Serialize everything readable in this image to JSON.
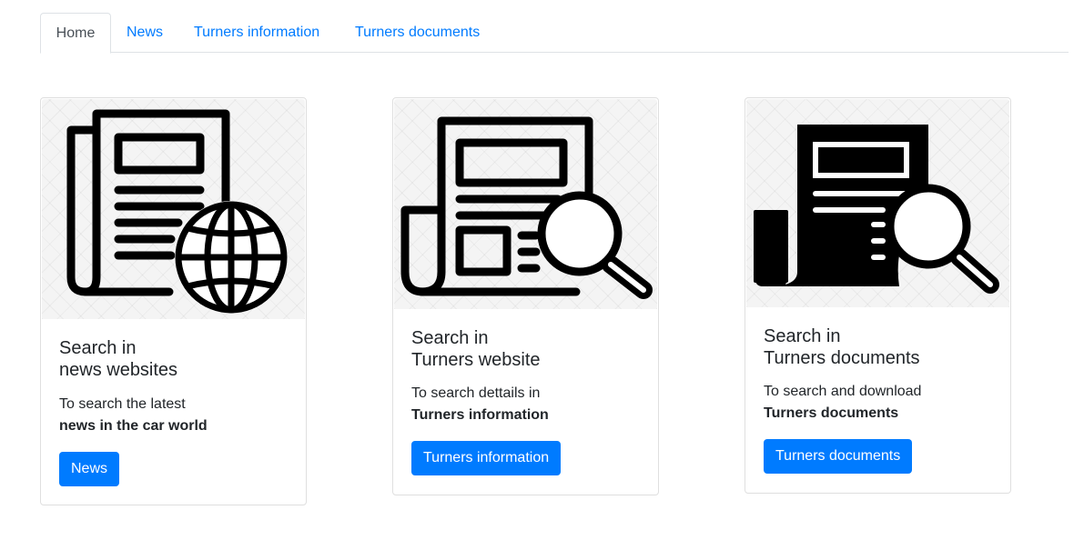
{
  "tabs": [
    {
      "label": "Home",
      "active": true
    },
    {
      "label": "News"
    },
    {
      "label": "Turners information"
    },
    {
      "label": "Turners documents"
    }
  ],
  "cards": [
    {
      "icon": "newspaper-globe-icon",
      "title_line1": "Search in",
      "title_line2": "news websites",
      "text_line1": "To search the latest",
      "text_line2": "news in the car world",
      "button": "News"
    },
    {
      "icon": "newspaper-magnifier-outline-icon",
      "title_line1": "Search in",
      "title_line2": "Turners website",
      "text_line1": "To search dettails in",
      "text_line2": "Turners information",
      "button": "Turners information"
    },
    {
      "icon": "newspaper-magnifier-solid-icon",
      "title_line1": "Search in",
      "title_line2": "Turners documents",
      "text_line1": "To search and download",
      "text_line2": "Turners documents",
      "button": "Turners documents"
    }
  ],
  "colors": {
    "primary": "#007bff",
    "tab_text": "#495057",
    "border": "#dee2e6"
  }
}
